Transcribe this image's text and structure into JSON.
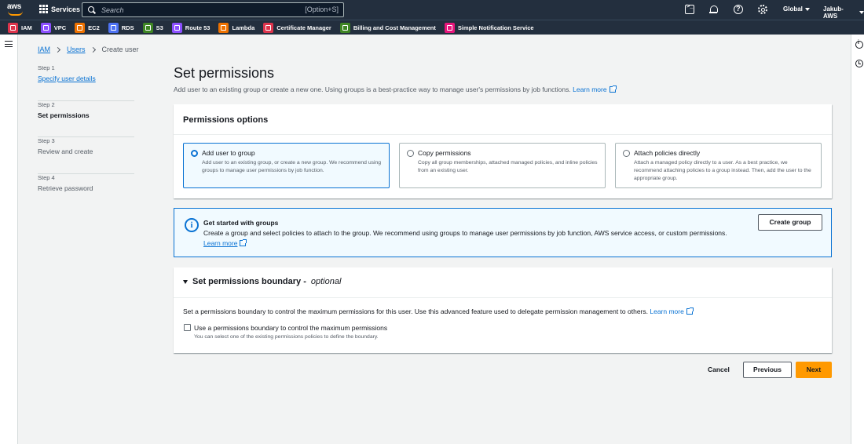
{
  "topnav": {
    "logo_text": "aws",
    "services_label": "Services",
    "search_placeholder": "Search",
    "search_shortcut": "[Option+S]",
    "region": "Global",
    "account": "Jakub-AWS"
  },
  "favorites": [
    {
      "label": "IAM",
      "color": "#dd344c"
    },
    {
      "label": "VPC",
      "color": "#8c4fff"
    },
    {
      "label": "EC2",
      "color": "#ed7100"
    },
    {
      "label": "RDS",
      "color": "#4d72f3"
    },
    {
      "label": "S3",
      "color": "#3f8624"
    },
    {
      "label": "Route 53",
      "color": "#8c4fff"
    },
    {
      "label": "Lambda",
      "color": "#ed7100"
    },
    {
      "label": "Certificate Manager",
      "color": "#dd344c"
    },
    {
      "label": "Billing and Cost Management",
      "color": "#3f8624"
    },
    {
      "label": "Simple Notification Service",
      "color": "#e7157b"
    }
  ],
  "breadcrumb": {
    "items": [
      "IAM",
      "Users"
    ],
    "current": "Create user"
  },
  "steps": [
    {
      "num": "Step 1",
      "label": "Specify user details",
      "state": "link"
    },
    {
      "num": "Step 2",
      "label": "Set permissions",
      "state": "active"
    },
    {
      "num": "Step 3",
      "label": "Review and create",
      "state": "inactive"
    },
    {
      "num": "Step 4",
      "label": "Retrieve password",
      "state": "inactive"
    }
  ],
  "page": {
    "title": "Set permissions",
    "subtitle": "Add user to an existing group or create a new one. Using groups is a best-practice way to manage user's permissions by job functions.",
    "learn_more": "Learn more"
  },
  "permissions": {
    "header": "Permissions options",
    "options": [
      {
        "title": "Add user to group",
        "desc": "Add user to an existing group, or create a new group. We recommend using groups to manage user permissions by job function.",
        "selected": true
      },
      {
        "title": "Copy permissions",
        "desc": "Copy all group memberships, attached managed policies, and inline policies from an existing user.",
        "selected": false
      },
      {
        "title": "Attach policies directly",
        "desc": "Attach a managed policy directly to a user. As a best practice, we recommend attaching policies to a group instead. Then, add the user to the appropriate group.",
        "selected": false
      }
    ]
  },
  "groups_info": {
    "title": "Get started with groups",
    "desc": "Create a group and select policies to attach to the group. We recommend using groups to manage user permissions by job function, AWS service access, or custom permissions.",
    "learn_more": "Learn more",
    "button": "Create group"
  },
  "boundary": {
    "title": "Set permissions boundary -",
    "optional": "optional",
    "desc": "Set a permissions boundary to control the maximum permissions for this user. Use this advanced feature used to delegate permission management to others.",
    "learn_more": "Learn more",
    "checkbox_label": "Use a permissions boundary to control the maximum permissions",
    "checkbox_desc": "You can select one of the existing permissions policies to define the boundary.",
    "checked": false
  },
  "footer": {
    "cancel": "Cancel",
    "previous": "Previous",
    "next": "Next"
  }
}
